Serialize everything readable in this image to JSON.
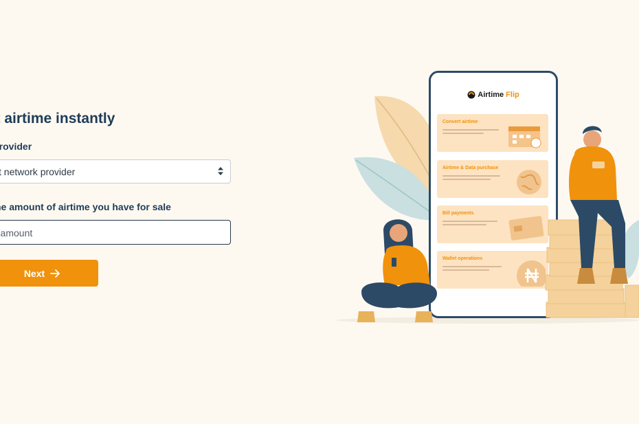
{
  "form": {
    "heading": "vert airtime instantly",
    "network_label": "rk provider",
    "network_select_value": "ct network provider",
    "amount_label": "he amount of airtime you have for sale",
    "amount_placeholder": "r amount",
    "next_label": "Next",
    "accent_color": "#f0920c"
  },
  "illustration": {
    "brand_prefix": "Airtime",
    "brand_suffix": "Flip",
    "cards": [
      {
        "title": "Convert airtime",
        "icon": "calendar-icon"
      },
      {
        "title": "Airtime & Data purchase",
        "icon": "globe-icon"
      },
      {
        "title": "Bill payments",
        "icon": "credit-card-icon"
      },
      {
        "title": "Wallet operations",
        "icon": "naira-coin-icon"
      }
    ]
  }
}
